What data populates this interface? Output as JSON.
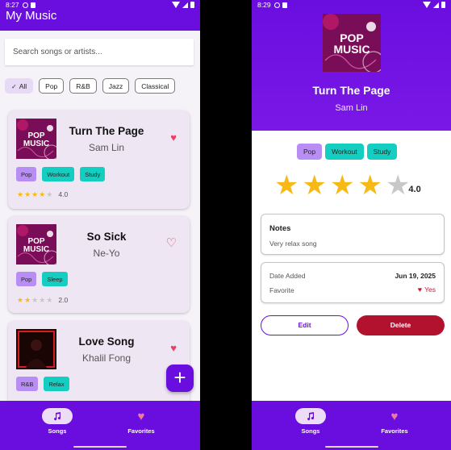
{
  "left_screen": {
    "status": {
      "time": "8:27"
    },
    "title": "My Music",
    "search": {
      "placeholder": "Search songs or artists..."
    },
    "filters": [
      {
        "label": "All",
        "selected": true
      },
      {
        "label": "Pop",
        "selected": false
      },
      {
        "label": "R&B",
        "selected": false
      },
      {
        "label": "Jazz",
        "selected": false
      },
      {
        "label": "Classical",
        "selected": false
      }
    ],
    "songs": [
      {
        "title": "Turn The Page",
        "artist": "Sam Lin",
        "favorite": true,
        "tags": [
          "Pop",
          "Workout",
          "Study"
        ],
        "rating": 4,
        "rating_text": "4.0"
      },
      {
        "title": "So Sick",
        "artist": "Ne-Yo",
        "favorite": false,
        "tags": [
          "Pop",
          "Sleep"
        ],
        "rating": 2,
        "rating_text": "2.0"
      },
      {
        "title": "Love Song",
        "artist": "Khalil Fong",
        "favorite": true,
        "tags": [
          "R&B",
          "Relax"
        ]
      }
    ],
    "fab_label": "+",
    "nav": {
      "songs": "Songs",
      "favorites": "Favorites"
    }
  },
  "right_screen": {
    "status": {
      "time": "8:29"
    },
    "title": "Turn The Page",
    "artist": "Sam Lin",
    "tags": [
      "Pop",
      "Workout",
      "Study"
    ],
    "rating": 4,
    "rating_text": "4.0",
    "notes": {
      "label": "Notes",
      "value": "Very relax song"
    },
    "info": {
      "date_label": "Date Added",
      "date_value": "Jun 19, 2025",
      "favorite_label": "Favorite",
      "favorite_value": "Yes"
    },
    "buttons": {
      "edit": "Edit",
      "delete": "Delete"
    },
    "nav": {
      "songs": "Songs",
      "favorites": "Favorites"
    }
  },
  "cover_art_text": {
    "line1": "POP",
    "line2": "MUSIC"
  },
  "colors": {
    "primary": "#6a0ee0",
    "tag_pop": "#b98ef4",
    "tag_teal": "#14cfc1",
    "heart": "#e83f62",
    "delete": "#b3122f",
    "star": "#f7b916"
  }
}
